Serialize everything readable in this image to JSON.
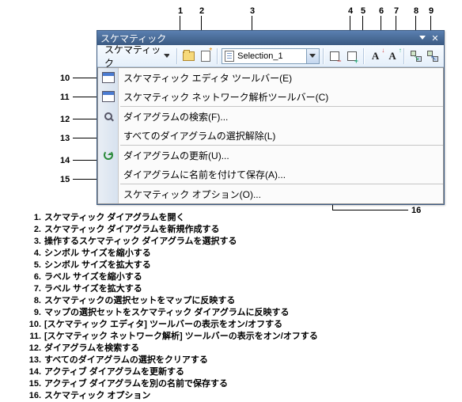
{
  "window": {
    "title": "スケマティック",
    "toolbar": {
      "menu_label": "スケマティック",
      "combo_value": "Selection_1"
    }
  },
  "menu": {
    "items": [
      {
        "label": "スケマティック エディタ ツールバー(E)",
        "icon": "editor-toolbar-icon"
      },
      {
        "label": "スケマティック ネットワーク解析ツールバー(C)",
        "icon": "network-toolbar-icon"
      }
    ],
    "items2": [
      {
        "label": "ダイアグラムの検索(F)...",
        "icon": "search-icon"
      },
      {
        "label": "すべてのダイアグラムの選択解除(L)",
        "icon": ""
      }
    ],
    "items3": [
      {
        "label": "ダイアグラムの更新(U)...",
        "icon": "refresh-icon"
      },
      {
        "label": "ダイアグラムに名前を付けて保存(A)...",
        "icon": ""
      }
    ],
    "items4": [
      {
        "label": "スケマティック オプション(O)...",
        "icon": ""
      }
    ]
  },
  "callouts_top": [
    "1",
    "2",
    "3",
    "4",
    "5",
    "6",
    "7",
    "8",
    "9"
  ],
  "callouts_left": [
    "10",
    "11",
    "12",
    "13",
    "14",
    "15"
  ],
  "callout_right": "16",
  "legend": [
    {
      "n": "1.",
      "t": "スケマティック ダイアグラムを開く"
    },
    {
      "n": "2.",
      "t": "スケマティック ダイアグラムを新規作成する"
    },
    {
      "n": "3.",
      "t": "操作するスケマティック ダイアグラムを選択する"
    },
    {
      "n": "4.",
      "t": "シンボル サイズを縮小する"
    },
    {
      "n": "5.",
      "t": "シンボル サイズを拡大する"
    },
    {
      "n": "6.",
      "t": "ラベル サイズを縮小する"
    },
    {
      "n": "7.",
      "t": "ラベル サイズを拡大する"
    },
    {
      "n": "8.",
      "t": "スケマティックの選択セットをマップに反映する"
    },
    {
      "n": "9.",
      "t": "マップの選択セットをスケマティック ダイアグラムに反映する"
    },
    {
      "n": "10.",
      "t": "[スケマティック エディタ] ツールバーの表示をオン/オフする"
    },
    {
      "n": "11.",
      "t": "[スケマティック ネットワーク解析] ツールバーの表示をオン/オフする"
    },
    {
      "n": "12.",
      "t": "ダイアグラムを検索する"
    },
    {
      "n": "13.",
      "t": "すべてのダイアグラムの選択をクリアする"
    },
    {
      "n": "14.",
      "t": "アクティブ ダイアグラムを更新する"
    },
    {
      "n": "15.",
      "t": "アクティブ ダイアグラムを別の名前で保存する"
    },
    {
      "n": "16.",
      "t": "スケマティック オプション"
    }
  ]
}
